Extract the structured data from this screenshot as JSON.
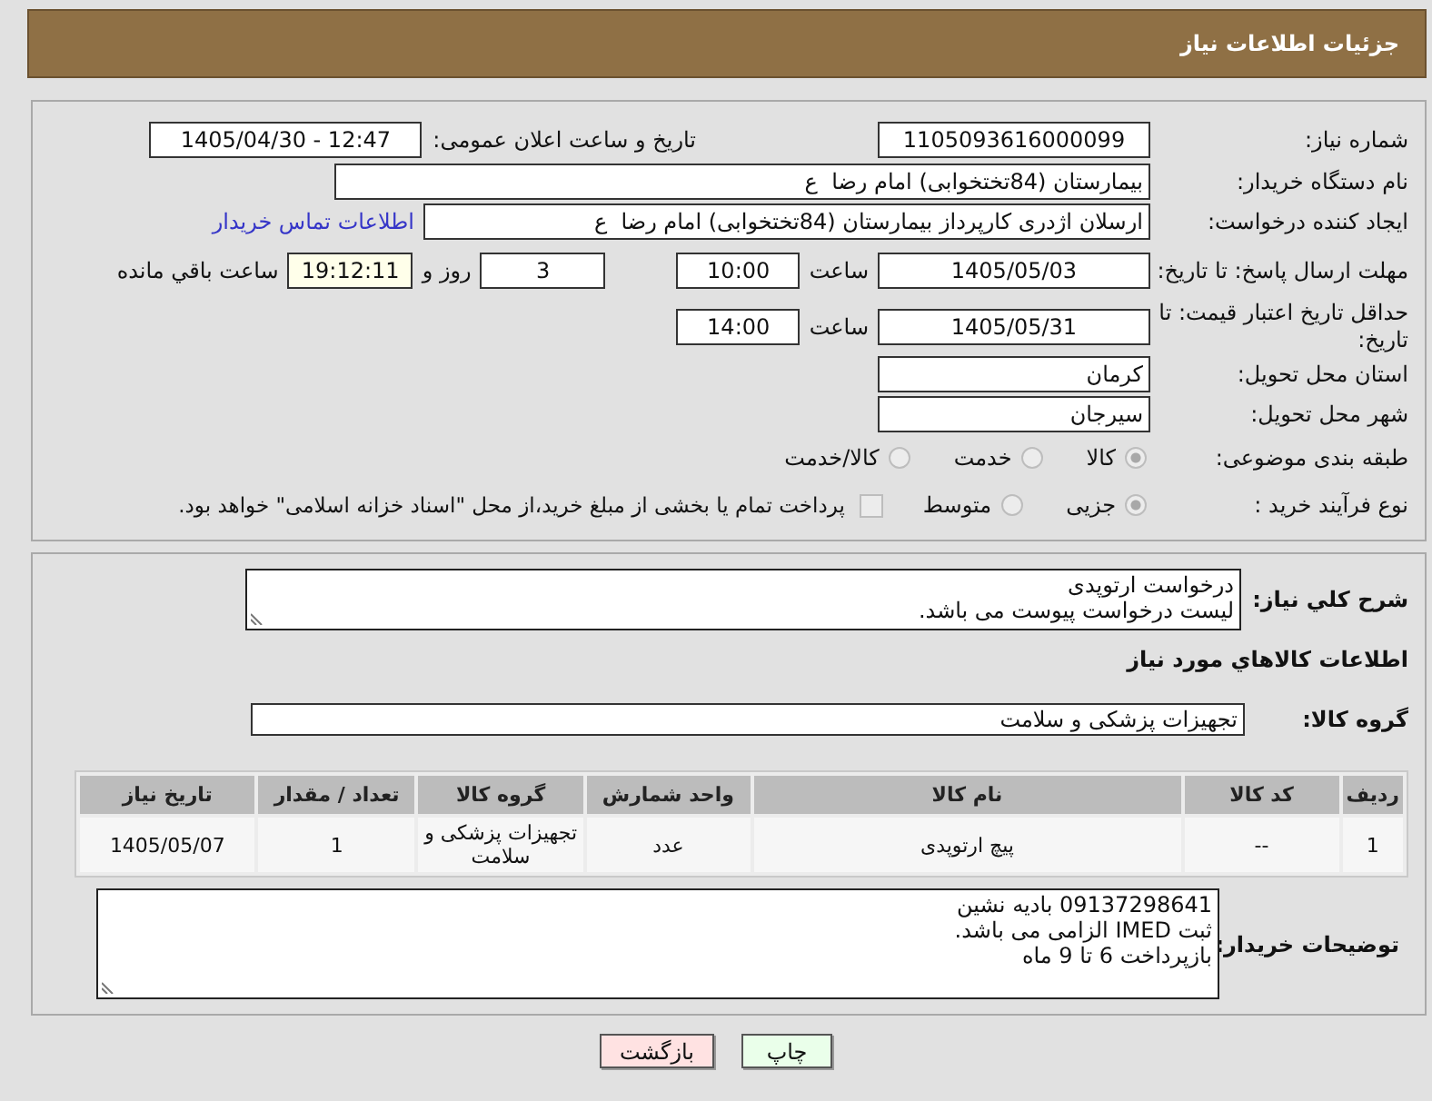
{
  "header": {
    "title": "جزئیات اطلاعات نیاز"
  },
  "form": {
    "need_number": {
      "label": "شماره نیاز:",
      "value": "1105093616000099"
    },
    "announcement": {
      "label": "تاریخ و ساعت اعلان عمومی:",
      "value": "1405/04/30 - 12:47"
    },
    "buyer_org": {
      "label": "نام دستگاه خریدار:",
      "value": "بیمارستان (84تختخوابی) امام رضا  ع"
    },
    "requester": {
      "label": "ایجاد کننده درخواست:",
      "value": "ارسلان اژدری کارپرداز بیمارستان (84تختخوابی) امام رضا  ع",
      "contact_link": "اطلاعات تماس خریدار"
    },
    "response_deadline": {
      "label": "مهلت ارسال پاسخ: تا تاریخ:",
      "date": "1405/05/03",
      "time_label": "ساعت",
      "time": "10:00",
      "days": "3",
      "days_label": "روز و",
      "remaining_time": "19:12:11",
      "remaining_label": "ساعت باقي مانده"
    },
    "price_validity": {
      "label": "حداقل تاریخ اعتبار قیمت: تا تاریخ:",
      "date": "1405/05/31",
      "time_label": "ساعت",
      "time": "14:00"
    },
    "delivery_province": {
      "label": "استان محل تحویل:",
      "value": "کرمان"
    },
    "delivery_city": {
      "label": "شهر محل تحویل:",
      "value": "سیرجان"
    },
    "subject_category": {
      "label": "طبقه بندی موضوعی:",
      "disabled": true,
      "options": [
        {
          "label": "کالا",
          "selected": true
        },
        {
          "label": "خدمت",
          "selected": false
        },
        {
          "label": "کالا/خدمت",
          "selected": false
        }
      ]
    },
    "purchase_process": {
      "label": "نوع فرآیند خرید :",
      "disabled": true,
      "options": [
        {
          "label": "جزیی",
          "selected": true
        },
        {
          "label": "متوسط",
          "selected": false
        }
      ],
      "treasury_payment": {
        "label": "پرداخت تمام یا بخشی از مبلغ خرید،از محل \"اسناد خزانه اسلامی\" خواهد بود.",
        "checked": false
      }
    }
  },
  "details": {
    "description": {
      "label": "شرح کلي نیاز:",
      "value": "درخواست ارتوپدی\nلیست درخواست پیوست می باشد."
    },
    "items_heading": "اطلاعات کالاهاي مورد نیاز",
    "goods_group": {
      "label": "گروه کالا:",
      "value": "تجهیزات پزشکی و سلامت"
    },
    "table": {
      "columns": [
        "ردیف",
        "کد کالا",
        "نام کالا",
        "واحد شمارش",
        "گروه کالا",
        "تعداد / مقدار",
        "تاریخ نیاز"
      ],
      "rows": [
        [
          "1",
          "--",
          "پیچ ارتوپدی",
          "عدد",
          "تجهیزات پزشکی و سلامت",
          "1",
          "1405/05/07"
        ]
      ]
    },
    "buyer_notes": {
      "label": "توضیحات خریدار:",
      "value": "09137298641 بادیه نشین\nثبت IMED الزامی می باشد.\nبازپرداخت 6 تا 9 ماه"
    }
  },
  "buttons": [
    {
      "label": "چاپ",
      "kind": "print"
    },
    {
      "label": "بازگشت",
      "kind": "back"
    }
  ]
}
